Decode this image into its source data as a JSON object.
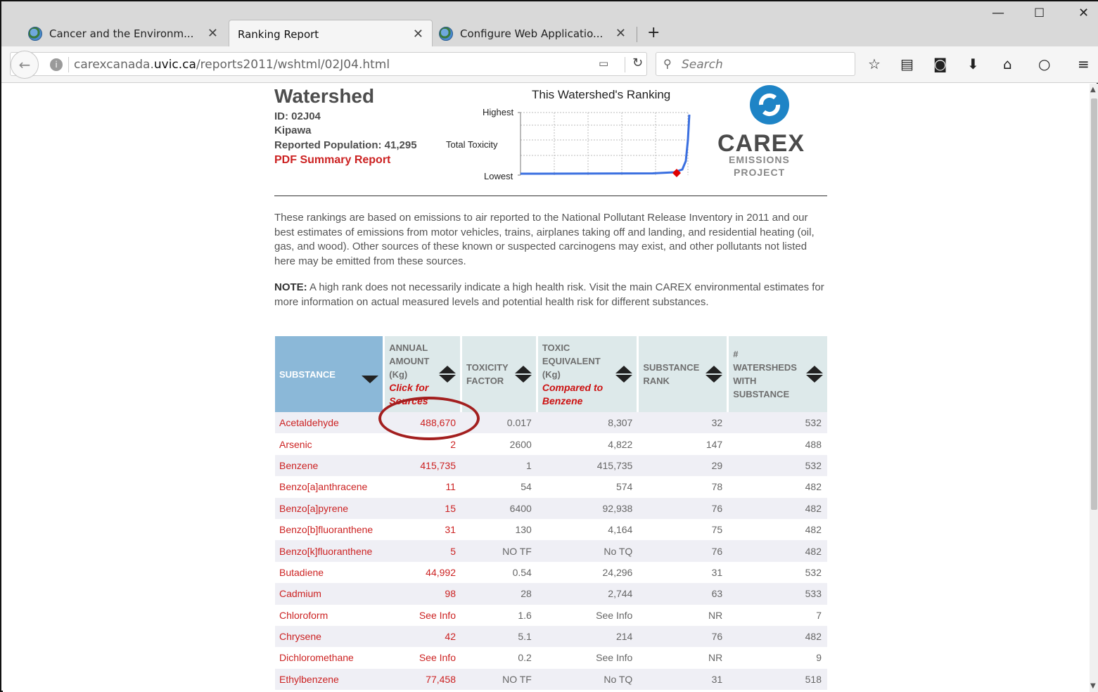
{
  "browser": {
    "tabs": [
      {
        "title": "Cancer and the Environm...",
        "active": false
      },
      {
        "title": "Ranking Report",
        "active": true
      },
      {
        "title": "Configure Web Applicatio...",
        "active": false
      }
    ],
    "url_pre": "carexcanada.",
    "url_domain": "uvic.ca",
    "url_path": "/reports2011/wshtml/02J04.html",
    "search_placeholder": "Search"
  },
  "header": {
    "title": "Watershed",
    "id_label": "ID: 02J04",
    "name": "Kipawa",
    "population_label": "Reported Population: 41,295",
    "pdf_link": "PDF Summary Report"
  },
  "ranking_chart": {
    "title": "This Watershed's Ranking",
    "ylabel": "Total Toxicity",
    "y_top_label": "Highest",
    "y_bottom_label": "Lowest",
    "line_color": "#3a6fe0",
    "marker_color": "#e00000"
  },
  "logo": {
    "word": "CAREX",
    "sub1": "EMISSIONS",
    "sub2": "PROJECT",
    "brand_color": "#1e84c6"
  },
  "intro": "These rankings are based on emissions to air reported to the National Pollutant Release Inventory in 2011 and our best estimates of emissions from motor vehicles, trains, airplanes taking off and landing, and residential heating (oil, gas, and wood). Other sources of these known or suspected carcinogens may exist, and other pollutants not listed here may be emitted from these sources.",
  "note_label": "NOTE:",
  "note_text": " A high rank does not necessarily indicate a high health risk. Visit the main CAREX environmental estimates for more information on actual measured levels and potential health risk for different substances.",
  "table": {
    "headers": {
      "substance": "SUBSTANCE",
      "amount": "ANNUAL AMOUNT (Kg)",
      "amount_sub": "Click for Sources",
      "factor": "TOXICITY FACTOR",
      "teq": "TOXIC EQUIVALENT (Kg)",
      "teq_sub": "Compared to Benzene",
      "rank": "SUBSTANCE RANK",
      "watersheds": "# WATERSHEDS WITH SUBSTANCE"
    },
    "rows": [
      {
        "substance": "Acetaldehyde",
        "amount": "488,670",
        "factor": "0.017",
        "teq": "8,307",
        "rank": "32",
        "watersheds": "532"
      },
      {
        "substance": "Arsenic",
        "amount": "2",
        "factor": "2600",
        "teq": "4,822",
        "rank": "147",
        "watersheds": "488"
      },
      {
        "substance": "Benzene",
        "amount": "415,735",
        "factor": "1",
        "teq": "415,735",
        "rank": "29",
        "watersheds": "532"
      },
      {
        "substance": "Benzo[a]anthracene",
        "amount": "11",
        "factor": "54",
        "teq": "574",
        "rank": "78",
        "watersheds": "482"
      },
      {
        "substance": "Benzo[a]pyrene",
        "amount": "15",
        "factor": "6400",
        "teq": "92,938",
        "rank": "76",
        "watersheds": "482"
      },
      {
        "substance": "Benzo[b]fluoranthene",
        "amount": "31",
        "factor": "130",
        "teq": "4,164",
        "rank": "75",
        "watersheds": "482"
      },
      {
        "substance": "Benzo[k]fluoranthene",
        "amount": "5",
        "factor": "NO TF",
        "teq": "No TQ",
        "rank": "76",
        "watersheds": "482"
      },
      {
        "substance": "Butadiene",
        "amount": "44,992",
        "factor": "0.54",
        "teq": "24,296",
        "rank": "31",
        "watersheds": "532"
      },
      {
        "substance": "Cadmium",
        "amount": "98",
        "factor": "28",
        "teq": "2,744",
        "rank": "63",
        "watersheds": "533"
      },
      {
        "substance": "Chloroform",
        "amount": "See Info",
        "factor": "1.6",
        "teq": "See Info",
        "rank": "NR",
        "watersheds": "7"
      },
      {
        "substance": "Chrysene",
        "amount": "42",
        "factor": "5.1",
        "teq": "214",
        "rank": "76",
        "watersheds": "482"
      },
      {
        "substance": "Dichloromethane",
        "amount": "See Info",
        "factor": "0.2",
        "teq": "See Info",
        "rank": "NR",
        "watersheds": "9"
      },
      {
        "substance": "Ethylbenzene",
        "amount": "77,458",
        "factor": "NO TF",
        "teq": "No TQ",
        "rank": "31",
        "watersheds": "518"
      }
    ]
  },
  "annotation": {
    "circle_color": "#a31f1f"
  }
}
